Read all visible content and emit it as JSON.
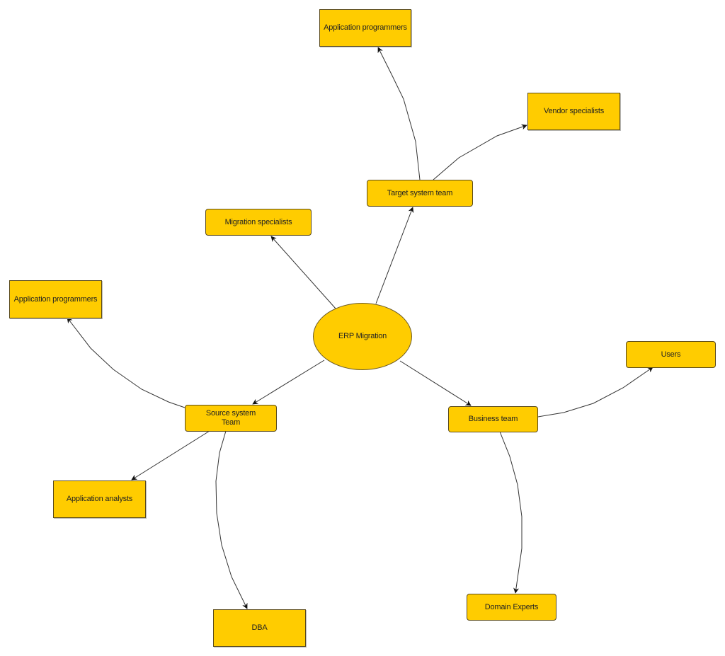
{
  "diagram": {
    "type": "mind-map",
    "fill_color": "#ffcc00",
    "border_color": "#5a4a1a",
    "edge_color": "#333333",
    "nodes": {
      "erp": {
        "label": "ERP Migration",
        "shape": "ellipse"
      },
      "target": {
        "label": "Target system team",
        "shape": "rounded"
      },
      "migration": {
        "label": "Migration specialists",
        "shape": "rounded"
      },
      "source": {
        "label": "Source system\nTeam",
        "shape": "rounded"
      },
      "business": {
        "label": "Business team",
        "shape": "rounded"
      },
      "appprog_top": {
        "label": "Application programmers",
        "shape": "rectangle"
      },
      "vendor": {
        "label": "Vendor specialists",
        "shape": "rectangle"
      },
      "appprog_left": {
        "label": "Application programmers",
        "shape": "rectangle"
      },
      "analysts": {
        "label": "Application analysts",
        "shape": "rectangle"
      },
      "dba": {
        "label": "DBA",
        "shape": "rectangle"
      },
      "users": {
        "label": "Users",
        "shape": "rounded"
      },
      "domain": {
        "label": "Domain Experts",
        "shape": "rounded"
      }
    },
    "edges": [
      {
        "from": "erp",
        "to": "target"
      },
      {
        "from": "erp",
        "to": "migration"
      },
      {
        "from": "erp",
        "to": "source"
      },
      {
        "from": "erp",
        "to": "business"
      },
      {
        "from": "target",
        "to": "appprog_top"
      },
      {
        "from": "target",
        "to": "vendor"
      },
      {
        "from": "source",
        "to": "appprog_left"
      },
      {
        "from": "source",
        "to": "analysts"
      },
      {
        "from": "source",
        "to": "dba"
      },
      {
        "from": "business",
        "to": "users"
      },
      {
        "from": "business",
        "to": "domain"
      }
    ]
  }
}
